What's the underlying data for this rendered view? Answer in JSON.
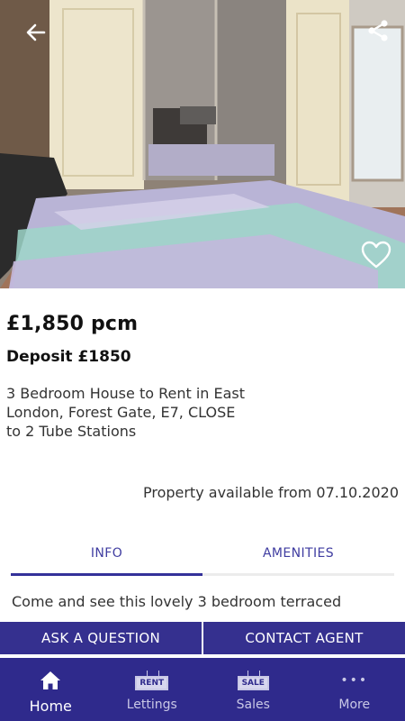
{
  "listing": {
    "price": "£1,850 pcm",
    "deposit": "Deposit £1850",
    "headline": "3 Bedroom House to Rent in East\nLondon, Forest Gate, E7, CLOSE\nto 2 Tube Stations",
    "availability": "Property available from 07.10.2020",
    "description": "Come and see this lovely 3 bedroom terraced"
  },
  "hero": {
    "image_alt": "Bedroom with double bed and mirrored wardrobe",
    "back_icon": "arrow-left-icon",
    "share_icon": "share-icon",
    "favourite_icon": "heart-outline-icon"
  },
  "tabs": [
    {
      "label": "INFO",
      "active": true
    },
    {
      "label": "AMENITIES",
      "active": false
    }
  ],
  "actions": {
    "ask": "ASK A QUESTION",
    "contact": "CONTACT AGENT"
  },
  "nav": {
    "items": [
      {
        "label": "Home",
        "icon": "home-icon"
      },
      {
        "label": "Lettings",
        "icon": "rent-sign-icon",
        "sign": "RENT"
      },
      {
        "label": "Sales",
        "icon": "sale-sign-icon",
        "sign": "SALE"
      },
      {
        "label": "More",
        "icon": "more-dots-icon"
      }
    ]
  },
  "colors": {
    "brand": "#2f2a8c",
    "button": "#35308f",
    "tab_text": "#3f3ca0"
  }
}
